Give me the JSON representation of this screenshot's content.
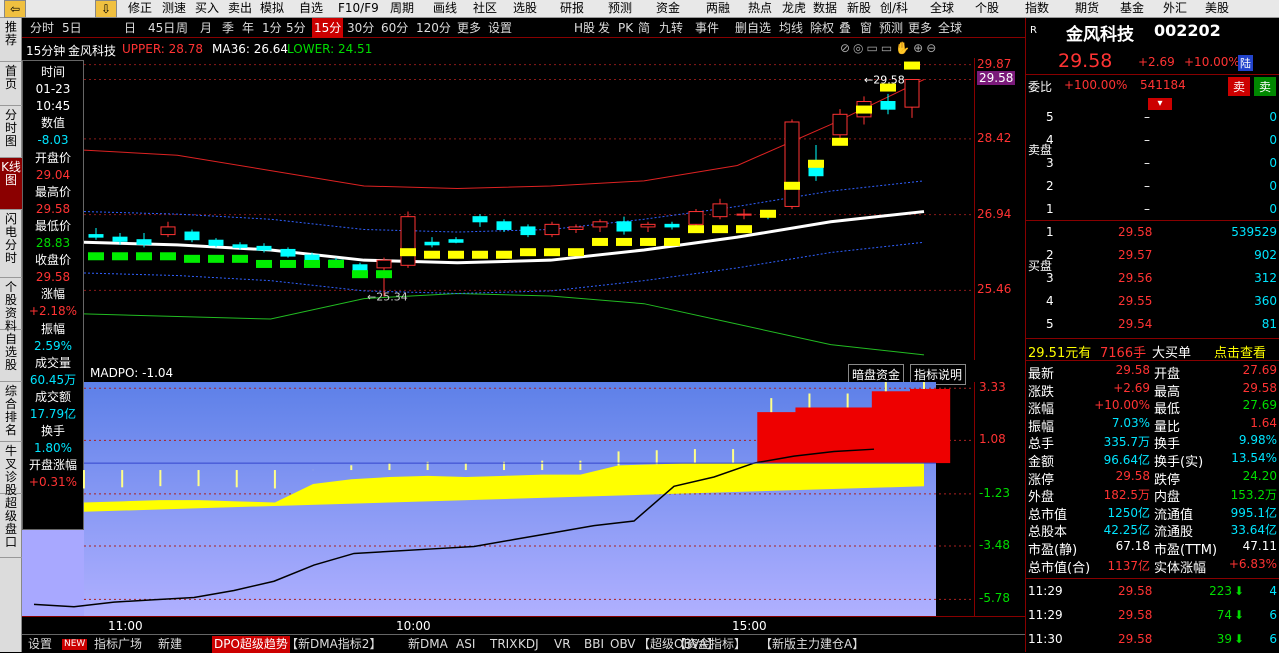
{
  "topbar": {
    "items": [
      "修正",
      "测速",
      "买入",
      "卖出",
      "模拟",
      "自选",
      "F10/F9",
      "周期",
      "画线",
      "社区",
      "选股",
      "研报",
      "预测",
      "资金",
      "两融",
      "热点",
      "龙虎",
      "数据",
      "新股",
      "创/科",
      "全球",
      "个股",
      "指数",
      "期货",
      "基金",
      "外汇",
      "美股"
    ]
  },
  "leftnav": [
    {
      "label": "推荐",
      "active": false
    },
    {
      "label": "首页",
      "active": false
    },
    {
      "label": "分时图",
      "active": false
    },
    {
      "label": "K线图",
      "active": true
    },
    {
      "label": "闪电分时",
      "active": false
    },
    {
      "label": "个股资料",
      "active": false
    },
    {
      "label": "自选股",
      "active": false
    },
    {
      "label": "综合排名",
      "active": false
    },
    {
      "label": "牛叉诊股",
      "active": false
    },
    {
      "label": "超级盘口",
      "active": false
    }
  ],
  "toolbar": {
    "items": [
      "分时",
      "5日",
      "日",
      "45日",
      "周",
      "月",
      "季",
      "年",
      "1分",
      "5分",
      "15分",
      "30分",
      "60分",
      "120分",
      "更多",
      "设置",
      "H股",
      "发",
      "PK",
      "简",
      "九转",
      "事件",
      "删自选",
      "均线",
      "除权",
      "叠",
      "窗",
      "预测",
      "更多",
      "全球"
    ],
    "selected": "15分"
  },
  "chart_header": {
    "period": "15分钟",
    "name": "金风科技",
    "upper": "UPPER: 28.78",
    "ma": "MA36: 26.64",
    "lower": "LOWER: 24.51"
  },
  "price_axis": {
    "labels": [
      "29.87",
      "29.58",
      "28.42",
      "26.94",
      "25.46"
    ],
    "values": [
      29.87,
      29.58,
      28.42,
      26.94,
      25.46
    ]
  },
  "annotations": {
    "high": "29.58",
    "low": "25.34"
  },
  "info": {
    "time_label": "时间",
    "date": "01-23",
    "time": "10:45",
    "value_label": "数值",
    "value": "-8.03",
    "open_label": "开盘价",
    "open": "29.04",
    "high_label": "最高价",
    "high": "29.58",
    "low_label": "最低价",
    "low": "28.83",
    "close_label": "收盘价",
    "close": "29.58",
    "chg_label": "涨幅",
    "chg": "+2.18%",
    "amp_label": "振幅",
    "amp": "2.59%",
    "vol_label": "成交量",
    "vol": "60.45万",
    "amt_label": "成交额",
    "amt": "17.79亿",
    "turn_label": "换手",
    "turn": "1.80%",
    "openchg_label": "开盘涨幅",
    "openchg": "+0.31%"
  },
  "indicator": {
    "label": "MADPO: -1.04",
    "btn1": "暗盘资金",
    "btn2": "指标说明",
    "axis_labels": [
      "3.33",
      "1.08",
      "-1.23",
      "-3.48",
      "-5.78"
    ],
    "axis_values": [
      3.33,
      1.08,
      -1.23,
      -3.48,
      -5.78
    ]
  },
  "time_axis": [
    "11:00",
    "10:00",
    "15:00"
  ],
  "bottombar": {
    "items": [
      "设置",
      "NEW",
      "指标广场",
      "新建",
      "DPO超级趋势",
      "【新DMA指标2】",
      "新DMA",
      "ASI",
      "TRIX",
      "KDJ",
      "VR",
      "BBI",
      "OBV",
      "【超级OBVA】",
      "【资金指标】",
      "【新版主力建仓A】"
    ],
    "selected": "DPO超级趋势"
  },
  "stock": {
    "badge": "R",
    "name": "金风科技",
    "code": "002202",
    "price": "29.58",
    "change": "+2.69",
    "pct": "+10.00%",
    "flag": "陆",
    "wb_label": "委比",
    "wb": "+100.00%",
    "wc": "541184",
    "sell_btn": "卖",
    "buy_btn": "卖"
  },
  "sell_levels": [
    {
      "n": "5",
      "price": "–",
      "vol": "0"
    },
    {
      "n": "4",
      "price": "–",
      "vol": "0"
    },
    {
      "n": "3",
      "price": "–",
      "vol": "0"
    },
    {
      "n": "2",
      "price": "–",
      "vol": "0"
    },
    {
      "n": "1",
      "price": "–",
      "vol": "0"
    }
  ],
  "sell_side_label": "卖盘",
  "buy_side_label": "买盘",
  "buy_levels": [
    {
      "n": "1",
      "price": "29.58",
      "vol": "539529"
    },
    {
      "n": "2",
      "price": "29.57",
      "vol": "902"
    },
    {
      "n": "3",
      "price": "29.56",
      "vol": "312"
    },
    {
      "n": "4",
      "price": "29.55",
      "vol": "360"
    },
    {
      "n": "5",
      "price": "29.54",
      "vol": "81"
    }
  ],
  "bigorder": {
    "price": "29.51元有",
    "qty": "7166手",
    "label": "大买单",
    "link": "点击查看"
  },
  "stats": [
    [
      "最新",
      "29.58",
      "开盘",
      "27.69"
    ],
    [
      "涨跌",
      "+2.69",
      "最高",
      "29.58"
    ],
    [
      "涨幅",
      "+10.00%",
      "最低",
      "27.69"
    ],
    [
      "振幅",
      "7.03%",
      "量比",
      "1.64"
    ],
    [
      "总手",
      "335.7万",
      "换手",
      "9.98%"
    ],
    [
      "金额",
      "96.64亿",
      "换手(实)",
      "13.54%"
    ],
    [
      "涨停",
      "29.58",
      "跌停",
      "24.20"
    ],
    [
      "外盘",
      "182.5万",
      "内盘",
      "153.2万"
    ],
    [
      "总市值",
      "1250亿",
      "流通值",
      "995.1亿"
    ],
    [
      "总股本",
      "42.25亿",
      "流通股",
      "33.64亿"
    ],
    [
      "市盈(静)",
      "67.18",
      "市盈(TTM)",
      "47.11"
    ],
    [
      "总市值(合)",
      "1137亿",
      "实体涨幅",
      "+6.83%"
    ]
  ],
  "ticks": [
    {
      "time": "11:29",
      "price": "29.58",
      "vol": "223",
      "n": "4"
    },
    {
      "time": "11:29",
      "price": "29.58",
      "vol": "74",
      "n": "6"
    },
    {
      "time": "11:30",
      "price": "29.58",
      "vol": "39",
      "n": "6"
    }
  ],
  "colors": {
    "up": "#ff3333",
    "down": "#00dd00",
    "yellow": "#ffff00",
    "accent": "#c00000"
  },
  "chart_data": [
    {
      "type": "candlestick",
      "series": [
        {
          "name": "15分钟 K线",
          "ohlc": [
            [
              26.55,
              26.68,
              26.45,
              26.5
            ],
            [
              26.5,
              26.58,
              26.35,
              26.42
            ],
            [
              26.45,
              26.58,
              26.3,
              26.36
            ],
            [
              26.55,
              26.8,
              26.5,
              26.7
            ],
            [
              26.6,
              26.65,
              26.4,
              26.45
            ],
            [
              26.44,
              26.48,
              26.3,
              26.34
            ],
            [
              26.35,
              26.4,
              26.25,
              26.3
            ],
            [
              26.32,
              26.38,
              26.2,
              26.25
            ],
            [
              26.26,
              26.3,
              26.1,
              26.13
            ],
            [
              26.15,
              26.2,
              26.0,
              26.05
            ],
            [
              26.05,
              26.1,
              25.9,
              25.96
            ],
            [
              25.96,
              26.0,
              25.75,
              25.8
            ],
            [
              25.9,
              26.1,
              25.34,
              26.05
            ],
            [
              25.95,
              27.0,
              25.9,
              26.9
            ],
            [
              26.4,
              26.5,
              26.3,
              26.35
            ],
            [
              26.45,
              26.5,
              26.38,
              26.4
            ],
            [
              26.9,
              26.95,
              26.7,
              26.8
            ],
            [
              26.8,
              26.85,
              26.6,
              26.65
            ],
            [
              26.7,
              26.75,
              26.5,
              26.55
            ],
            [
              26.55,
              26.8,
              26.5,
              26.75
            ],
            [
              26.65,
              26.75,
              26.58,
              26.7
            ],
            [
              26.7,
              26.85,
              26.6,
              26.8
            ],
            [
              26.8,
              26.9,
              26.55,
              26.62
            ],
            [
              26.7,
              26.8,
              26.6,
              26.75
            ],
            [
              26.75,
              26.8,
              26.65,
              26.7
            ],
            [
              26.75,
              27.05,
              26.7,
              27.0
            ],
            [
              26.9,
              27.25,
              26.85,
              27.15
            ],
            [
              26.95,
              27.05,
              26.85,
              26.95
            ],
            [
              26.92,
              27.02,
              26.85,
              26.9
            ],
            [
              27.1,
              28.8,
              27.05,
              28.75
            ],
            [
              28.0,
              28.3,
              27.6,
              27.7
            ],
            [
              28.5,
              29.0,
              28.3,
              28.9
            ],
            [
              28.85,
              29.25,
              28.7,
              29.15
            ],
            [
              29.15,
              29.3,
              28.9,
              29.0
            ],
            [
              29.04,
              29.58,
              28.83,
              29.58
            ]
          ]
        }
      ],
      "bands": {
        "upper": [
          28.2,
          28.1,
          27.8,
          27.5,
          27.45,
          27.5,
          27.6,
          27.9,
          28.7,
          29.58
        ],
        "ma36": [
          26.4,
          26.35,
          26.25,
          26.05,
          26.0,
          26.05,
          26.25,
          26.5,
          26.8,
          27.0
        ],
        "lower": [
          25.0,
          24.95,
          24.9,
          25.3,
          25.4,
          25.35,
          25.2,
          24.8,
          24.4,
          24.2
        ]
      },
      "title": "",
      "xlabel": "",
      "ylabel": ""
    },
    {
      "type": "area",
      "series": [
        {
          "name": "MADPO",
          "values": [
            -1.6,
            -1.55,
            -1.5,
            -1.5,
            -1.55,
            -1.6,
            -0.8,
            -0.6,
            -0.5,
            -0.45,
            -0.5,
            -0.45,
            -0.4,
            -0.4,
            0.0,
            0.05,
            0.1,
            0.1,
            2.3,
            2.5,
            2.5,
            3.2,
            3.3
          ]
        }
      ],
      "ylim": [
        -6.5,
        3.6
      ]
    }
  ]
}
